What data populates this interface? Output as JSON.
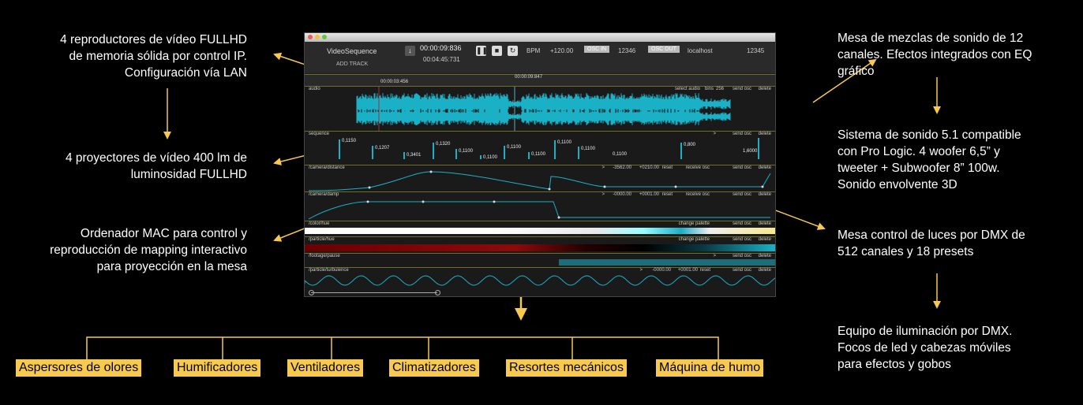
{
  "left_notes": [
    {
      "lines": [
        "4 reproductores de vídeo FULLHD",
        "de memoria sólida por control IP.",
        "Configuración vía LAN"
      ]
    },
    {
      "lines": [
        "4 proyectores de vídeo 400 lm de",
        "luminosidad FULLHD"
      ]
    },
    {
      "lines": [
        "Ordenador MAC para control y",
        "reproducción de mapping interactivo",
        "para proyección en la mesa"
      ]
    }
  ],
  "right_notes": [
    {
      "lines": [
        "Mesa de mezclas de sonido de 12",
        "canales. Efectos integrados con EQ",
        "gráfico"
      ]
    },
    {
      "lines": [
        "Sistema de sonido 5.1 compatible",
        "con Pro Logic. 4 woofer 6,5” y",
        "tweeter  + Subwoofer 8” 100w.",
        "Sonido envolvente 3D"
      ]
    },
    {
      "lines": [
        "Mesa control de luces por DMX de",
        "512 canales y 18 presets"
      ]
    },
    {
      "lines": [
        "Equipo de iluminación por DMX.",
        "Focos de led y cabezas móviles",
        "para efectos y gobos"
      ]
    }
  ],
  "devices": [
    "Aspersores de olores",
    "Humificadores",
    "Ventiladores",
    "Climatizadores",
    "Resortes mecánicos",
    "Máquina de humo"
  ],
  "app": {
    "title": "VideoSequence",
    "add_track": "ADD TRACK",
    "time_current": "00:00:09:836",
    "time_total": "00:04:45:731",
    "bpm_label": "BPM",
    "bpm_value": "+120.00",
    "osc_in_label": "OSC IN",
    "osc_in_port": "12346",
    "osc_out_label": "OSC OUT",
    "osc_out_host": "localhost",
    "osc_out_port": "12345",
    "ruler_time_1": "00:00:03:456",
    "ruler_time_2": "00:00:09:847",
    "tracks": {
      "audio": {
        "name": "audio",
        "select": "select audio",
        "bins_label": "bins",
        "bins": "256",
        "send": "send osc",
        "delete": "delete"
      },
      "sequence": {
        "name": "sequence",
        "arrow": ">",
        "send": "send osc",
        "delete": "delete",
        "values": [
          "0,1150",
          "0,1207",
          "0,3401",
          "0,1320",
          "0,1100",
          "0,1100",
          "0,1100",
          "0,1100",
          "0,1100",
          "0,1100",
          "0,1100",
          "0,800",
          "1,6000"
        ]
      },
      "camera_distance": {
        "name": "/camera/distance",
        "arrow": ">",
        "min": "-3562.00",
        "max": "+0210.00",
        "reset": "reset",
        "receive": "receive osc",
        "send": "send osc",
        "delete": "delete"
      },
      "camera_damp": {
        "name": "/camera/damp",
        "arrow": ">",
        "min": "-0000.00",
        "max": "+0001.00",
        "reset": "reset",
        "receive": "receive osc",
        "send": "send osc",
        "delete": "delete"
      },
      "color_hue": {
        "name": "/color/hue",
        "change": "change palette",
        "send": "send osc",
        "delete": "delete"
      },
      "particle_hue": {
        "name": "/particle/hue",
        "change": "change palette",
        "send": "send osc",
        "delete": "delete"
      },
      "footage_pause": {
        "name": "/footage/pause",
        "arrow": ">",
        "send": "send osc",
        "delete": "delete"
      },
      "particle_turbulence": {
        "name": "/particle/turbulence",
        "arrow": ">",
        "min": "-0000.00",
        "max": "+0001.00",
        "reset": "reset",
        "send": "send osc",
        "delete": "delete"
      }
    }
  },
  "colors": {
    "accent": "#f7c94e",
    "wave": "#1ab0c6",
    "playhead": "#5aa9c9",
    "highlight_bg": "#f7c94e",
    "lane_border": "#6e6e2a"
  }
}
